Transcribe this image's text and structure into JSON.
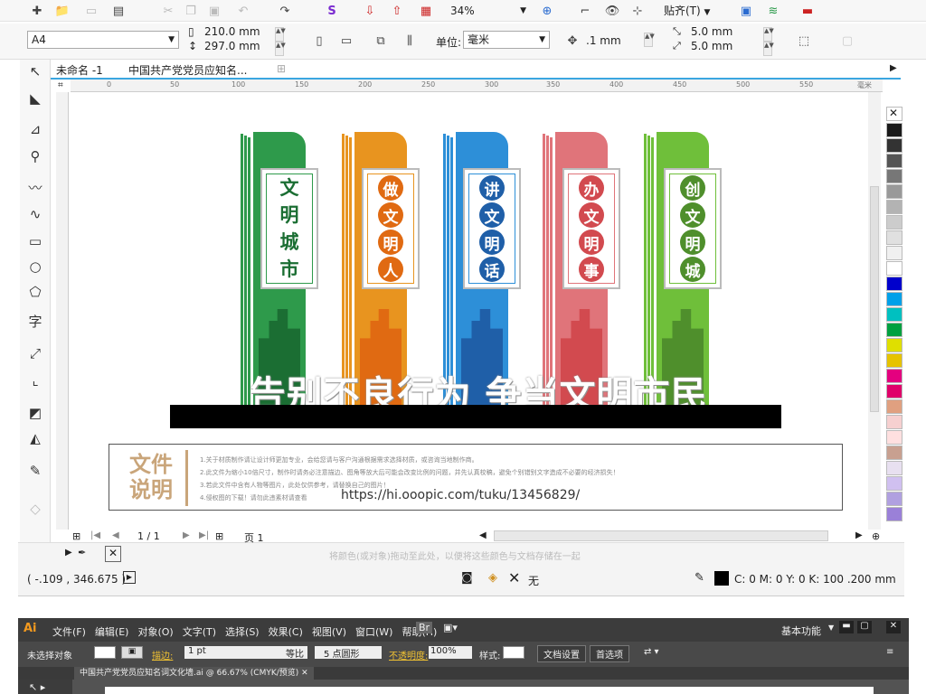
{
  "toolbar1": {
    "zoom": "34%",
    "snap_label": "贴齐(T)"
  },
  "toolbar2": {
    "page_size": "A4",
    "width": "210.0 mm",
    "height": "297.0 mm",
    "unit_label": "单位:",
    "unit_value": "毫米",
    "nudge": ".1 mm",
    "dup_x": "5.0 mm",
    "dup_y": "5.0 mm"
  },
  "tabs": [
    "未命名 -1",
    "中国共产党党员应知名..."
  ],
  "ruler": {
    "marks": [
      "0",
      "50",
      "100",
      "150",
      "200",
      "250",
      "300",
      "350",
      "400",
      "450",
      "500",
      "550",
      "毫米"
    ]
  },
  "signs": [
    {
      "chars": [
        "文",
        "明",
        "城",
        "市"
      ],
      "color": "#2e9a4b",
      "dark": "#1b6e33"
    },
    {
      "chars": [
        "做",
        "文",
        "明",
        "人"
      ],
      "color": "#e8941f",
      "dark": "#e06a12"
    },
    {
      "chars": [
        "讲",
        "文",
        "明",
        "话"
      ],
      "color": "#2d8fd8",
      "dark": "#1f5fa8"
    },
    {
      "chars": [
        "办",
        "文",
        "明",
        "事"
      ],
      "color": "#e0747a",
      "dark": "#d24a4f"
    },
    {
      "chars": [
        "创",
        "文",
        "明",
        "城"
      ],
      "color": "#6fbf3a",
      "dark": "#4f8f2c"
    }
  ],
  "slogan": "告别不良行为 争当文明市民",
  "notes": {
    "title_line1": "文件",
    "title_line2": "说明",
    "items": [
      "1.关于材质制作请让设计师更加专业，会给您请与客户沟通根据需求选择材质，或咨询当地制作商。",
      "2.此文件为缩小10倍尺寸，制作时请务必注意描边、图角等放大后可能会改变比例的问题，并先认真校稿，避免个别错别文字造成不必要的经济损失！",
      "3.若此文件中含有人物等图片，此处仅供参考，请替换自己的图片！",
      "4.侵权图的下载！请勿此违素材请查看"
    ],
    "url": "https://hi.ooopic.com/tuku/13456829/"
  },
  "pager": {
    "count": "1 / 1",
    "page_label": "页 1"
  },
  "hint": "将颜色(或对象)拖动至此处，以便将这些颜色与文档存储在一起",
  "coords": "( -.109 , 346.675 )",
  "color_info": "C: 0 M: 0 Y: 0 K: 100  .200 mm",
  "fill_none": "无",
  "palette": [
    "#1a1a1a",
    "#333333",
    "#555555",
    "#777777",
    "#999999",
    "#b3b3b3",
    "#cccccc",
    "#e0e0e0",
    "#f0f0f0",
    "#ffffff",
    "#0000cc",
    "#00a0e9",
    "#00c0c0",
    "#00a040",
    "#dfdf00",
    "#e6c300",
    "#e4007f",
    "#e0006a",
    "#e0a080",
    "#f6d0d0",
    "#ffe0e0",
    "#c8a090",
    "#e8e0f0",
    "#d0c0f0",
    "#b0a0e0",
    "#9a80d8"
  ],
  "ai": {
    "menus": [
      "文件(F)",
      "编辑(E)",
      "对象(O)",
      "文字(T)",
      "选择(S)",
      "效果(C)",
      "视图(V)",
      "窗口(W)",
      "帮助(H)"
    ],
    "workspace": "基本功能",
    "ctrl": {
      "select": "未选择对象",
      "stroke_label": "描边:",
      "stroke_val": "1 pt",
      "line": "等比",
      "brush": "5 点圆形",
      "opacity_label": "不透明度:",
      "opacity_val": "100%",
      "style_label": "样式:",
      "doc_btn": "文档设置",
      "pref_btn": "首选项"
    },
    "doc_tab": "中国共产党党员应知名词文化墙.ai @ 66.67% (CMYK/预览)"
  }
}
